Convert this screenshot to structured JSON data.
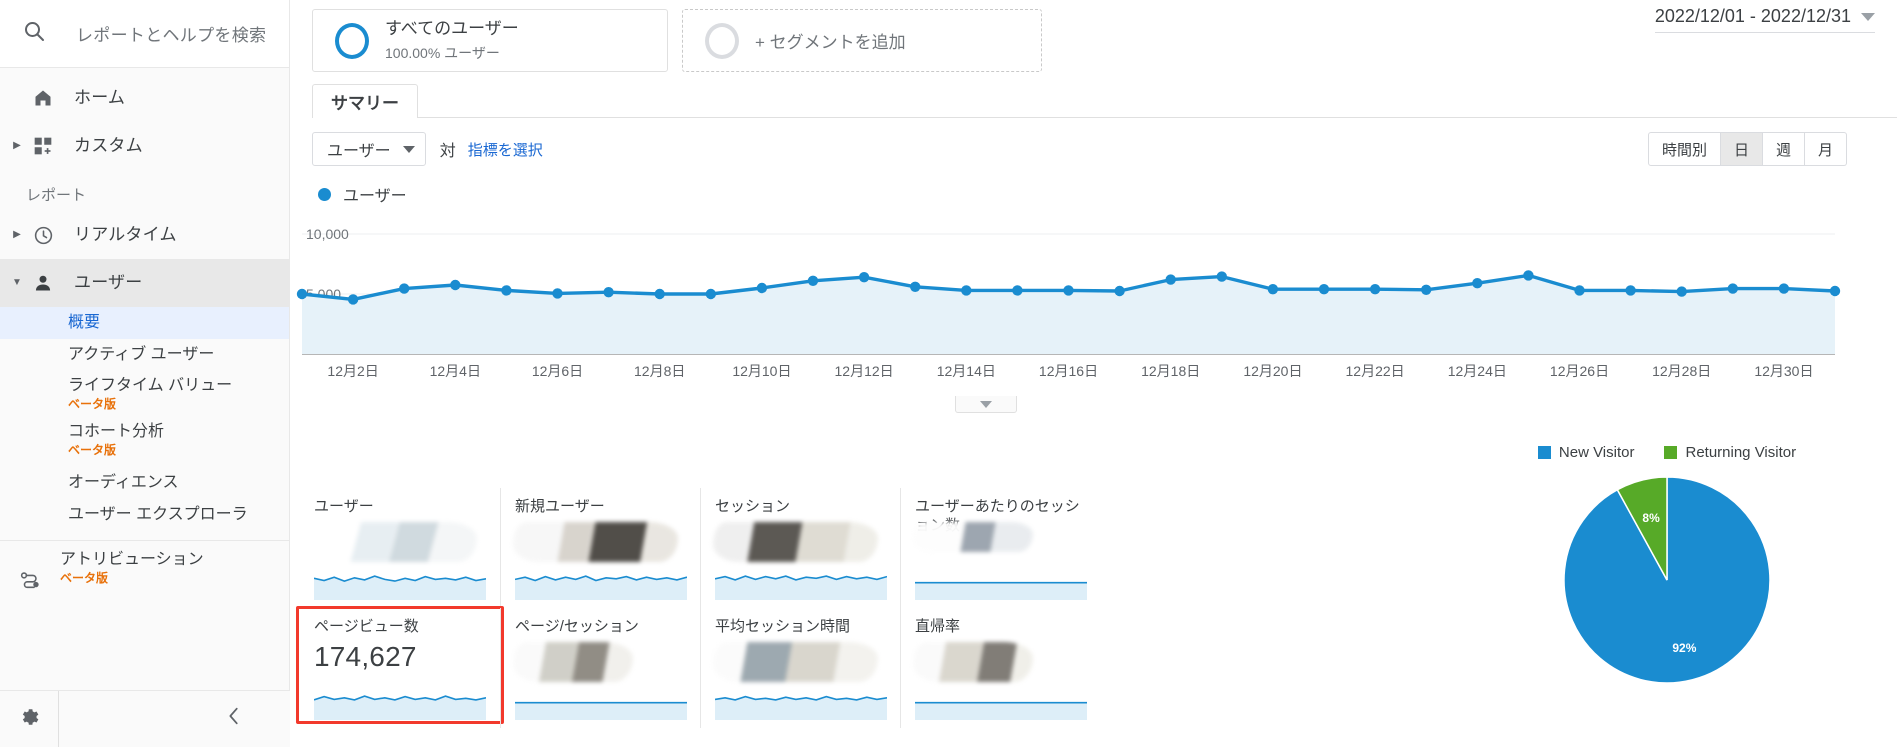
{
  "sidebar": {
    "search_placeholder": "レポートとヘルプを検索",
    "search_icon": "search-icon",
    "top_items": [
      {
        "label": "ホーム",
        "icon": "home-icon",
        "expandable": false
      },
      {
        "label": "カスタム",
        "icon": "custom-grid-icon",
        "expandable": true
      }
    ],
    "section_label": "レポート",
    "report_items": [
      {
        "label": "リアルタイム",
        "icon": "clock-icon",
        "expandable": true,
        "active": false
      },
      {
        "label": "ユーザー",
        "icon": "person-icon",
        "expandable": true,
        "active": true
      }
    ],
    "user_subitems": [
      {
        "label": "概要",
        "selected": true,
        "beta": ""
      },
      {
        "label": "アクティブ ユーザー",
        "selected": false,
        "beta": ""
      },
      {
        "label": "ライフタイム バリュー",
        "selected": false,
        "beta": "ベータ版"
      },
      {
        "label": "コホート分析",
        "selected": false,
        "beta": "ベータ版"
      },
      {
        "label": "オーディエンス",
        "selected": false,
        "beta": ""
      },
      {
        "label": "ユーザー エクスプローラ",
        "selected": false,
        "beta": ""
      }
    ],
    "attribution": {
      "label": "アトリビューション",
      "beta": "ベータ版",
      "icon": "attribution-icon"
    },
    "footer": {
      "settings_icon": "gear-icon",
      "collapse_icon": "chevron-left-icon"
    }
  },
  "header": {
    "date_range": "2022/12/01 - 2022/12/31",
    "date_range_caret": "chevron-down-icon",
    "segments": [
      {
        "title": "すべてのユーザー",
        "subtitle": "100.00% ユーザー",
        "ring_color": "#1a8cd0"
      }
    ],
    "add_segment_label": "+ セグメントを追加"
  },
  "tabs": [
    {
      "label": "サマリー",
      "active": true
    }
  ],
  "controls": {
    "metric_select_value": "ユーザー",
    "metric_select_caret": "chevron-down-icon",
    "vs_label": "対",
    "pick_metric_label": "指標を選択",
    "granularity": [
      {
        "label": "時間別",
        "active": false
      },
      {
        "label": "日",
        "active": true
      },
      {
        "label": "週",
        "active": false
      },
      {
        "label": "月",
        "active": false
      }
    ]
  },
  "chart_data": {
    "type": "line",
    "title": "",
    "legend": [
      {
        "name": "ユーザー",
        "color": "#1a8cd0"
      }
    ],
    "legend_position": "top-left",
    "xlabel": "",
    "ylabel": "",
    "ylim": [
      0,
      10000
    ],
    "y_ticks": [
      "10,000",
      "5,000"
    ],
    "y_tick_values": [
      10000,
      5000
    ],
    "grid": true,
    "x_tick_labels": [
      "12月2日",
      "12月4日",
      "12月6日",
      "12月8日",
      "12月10日",
      "12月12日",
      "12月14日",
      "12月16日",
      "12月18日",
      "12月20日",
      "12月22日",
      "12月24日",
      "12月26日",
      "12月28日",
      "12月30日"
    ],
    "x": [
      "12月1日",
      "12月2日",
      "12月3日",
      "12月4日",
      "12月5日",
      "12月6日",
      "12月7日",
      "12月8日",
      "12月9日",
      "12月10日",
      "12月11日",
      "12月12日",
      "12月13日",
      "12月14日",
      "12月15日",
      "12月16日",
      "12月17日",
      "12月18日",
      "12月19日",
      "12月20日",
      "12月21日",
      "12月22日",
      "12月23日",
      "12月24日",
      "12月25日",
      "12月26日",
      "12月27日",
      "12月28日",
      "12月29日",
      "12月30日",
      "12月31日"
    ],
    "series": [
      {
        "name": "ユーザー",
        "color": "#1a8cd0",
        "values": [
          5000,
          4550,
          5450,
          5750,
          5300,
          5050,
          5150,
          5000,
          5000,
          5500,
          6100,
          6400,
          5600,
          5300,
          5300,
          5300,
          5250,
          6200,
          6450,
          5400,
          5400,
          5400,
          5350,
          5900,
          6550,
          5300,
          5300,
          5200,
          5450,
          5450,
          5250
        ]
      }
    ],
    "collapse_button_icon": "chevron-down-icon"
  },
  "metric_cards": [
    [
      {
        "title": "ユーザー",
        "value": "",
        "redacted": true,
        "highlighted": false
      },
      {
        "title": "新規ユーザー",
        "value": "",
        "redacted": true,
        "highlighted": false
      },
      {
        "title": "セッション",
        "value": "",
        "redacted": true,
        "highlighted": false
      },
      {
        "title": "ユーザーあたりのセッション数",
        "value": "",
        "redacted": true,
        "highlighted": false
      }
    ],
    [
      {
        "title": "ページビュー数",
        "value": "174,627",
        "redacted": false,
        "highlighted": true
      },
      {
        "title": "ページ/セッション",
        "value": "",
        "redacted": true,
        "highlighted": false
      },
      {
        "title": "平均セッション時間",
        "value": "",
        "redacted": true,
        "highlighted": false
      },
      {
        "title": "直帰率",
        "value": "",
        "redacted": true,
        "highlighted": false
      }
    ]
  ],
  "pie_chart": {
    "type": "pie",
    "title": "",
    "legend_position": "top",
    "labels": [
      "New Visitor",
      "Returning Visitor"
    ],
    "values": [
      92,
      8
    ],
    "value_labels": [
      "92%",
      "8%"
    ],
    "colors": [
      "#1a8cd0",
      "#57aa28"
    ]
  },
  "colors": {
    "accent_blue": "#1a8cd0",
    "green": "#57aa28",
    "highlight_red": "#f2392c",
    "link_blue": "#1967d2",
    "beta_orange": "#e8710a"
  }
}
